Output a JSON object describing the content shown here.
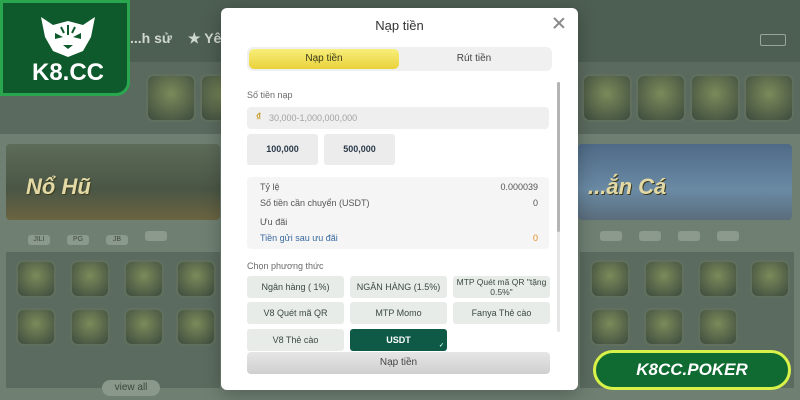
{
  "background": {
    "tabs": [
      "...h sử",
      "★ Yê..."
    ],
    "banner_left_title": "Nổ Hũ",
    "banner_right_title": "...ắn Cá",
    "provider_pills": [
      "JILI",
      "PG",
      "JB",
      "",
      "",
      ""
    ],
    "view_all": "view all"
  },
  "logo": {
    "text": "K8.CC",
    "icon": "tiger-head-icon"
  },
  "modal": {
    "title": "Nạp tiền",
    "close_icon": "close-icon",
    "tabs": {
      "deposit": "Nạp tiền",
      "withdraw": "Rút tiền"
    },
    "amount_label": "Số tiền nạp",
    "amount_placeholder": "30,000-1,000,000,000",
    "coin_icon": "coin-icon",
    "presets": [
      "100,000",
      "500,000"
    ],
    "info": {
      "rate_label": "Tỷ lệ",
      "rate_value": "0.000039",
      "convert_label": "Số tiền cần chuyển (USDT)",
      "convert_value": "0",
      "promo_label": "Ưu đãi",
      "after_promo_label": "Tiền gửi sau ưu đãi",
      "after_promo_value": "0"
    },
    "method_label": "Chọn phương thức",
    "methods": [
      "Ngân hàng ( 1%)",
      "NGÂN HÀNG (1.5%)",
      "MTP Quét mã QR \"tặng 0.5%\"",
      "V8 Quét mã QR",
      "MTP Momo",
      "Fanya Thẻ cào",
      "V8 Thẻ cào",
      "USDT"
    ],
    "selected_method": "USDT",
    "submit_label": "Nạp tiền"
  },
  "watermark": {
    "text": "K8CC.POKER"
  },
  "colors": {
    "accent_yellow": "#e9d23a",
    "selected_green": "#0f5a47",
    "orange_value": "#e08a1e",
    "brand_green": "#0f6b32",
    "brand_border": "#d9f24a"
  }
}
